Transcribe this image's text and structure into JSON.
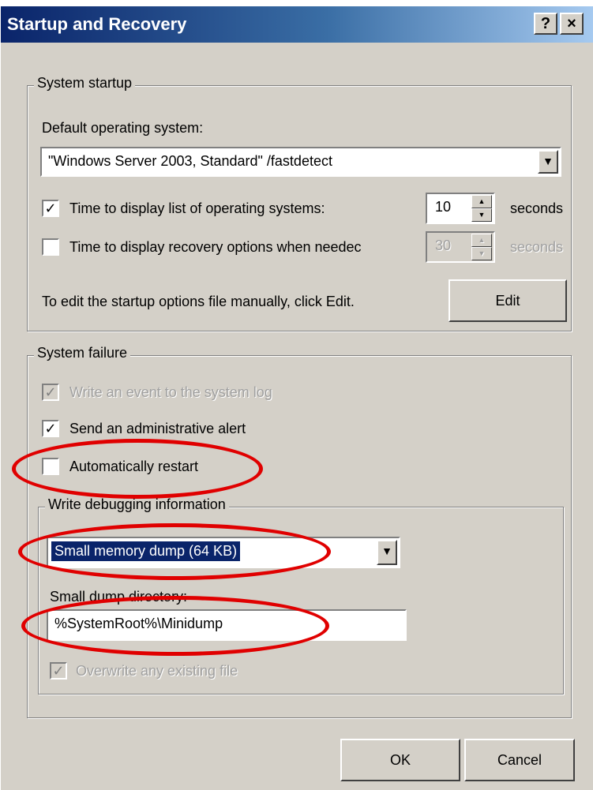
{
  "window": {
    "title": "Startup and Recovery",
    "help_button": "?",
    "close_button": "×"
  },
  "system_startup": {
    "group_label": "System startup",
    "default_os_label": "Default operating system:",
    "default_os_value": "\"Windows Server 2003, Standard\" /fastdetect",
    "display_list": {
      "checked": true,
      "label": "Time to display list of operating systems:",
      "value": "10",
      "unit": "seconds"
    },
    "display_recovery": {
      "checked": false,
      "label": "Time to display recovery options when needec",
      "value": "30",
      "unit": "seconds"
    },
    "edit_hint": "To edit the startup options file manually, click Edit.",
    "edit_button": "Edit"
  },
  "system_failure": {
    "group_label": "System failure",
    "write_event": {
      "checked": true,
      "enabled": false,
      "label": "Write an event to the system log"
    },
    "send_alert": {
      "checked": true,
      "enabled": true,
      "label": "Send an administrative alert"
    },
    "auto_restart": {
      "checked": false,
      "enabled": true,
      "label": "Automatically restart"
    },
    "debug_info": {
      "group_label": "Write debugging information",
      "dump_type": "Small memory dump (64 KB)",
      "dump_dir_label": "Small dump directory:",
      "dump_dir_value": "%SystemRoot%\\Minidump",
      "overwrite": {
        "checked": true,
        "enabled": false,
        "label": "Overwrite any existing file"
      }
    }
  },
  "footer": {
    "ok_button": "OK",
    "cancel_button": "Cancel"
  },
  "annotations": {
    "highlight_color": "#e00000"
  },
  "icons": [
    "checkmark-icon",
    "dropdown-arrow-icon",
    "spin-up-icon",
    "spin-down-icon"
  ]
}
